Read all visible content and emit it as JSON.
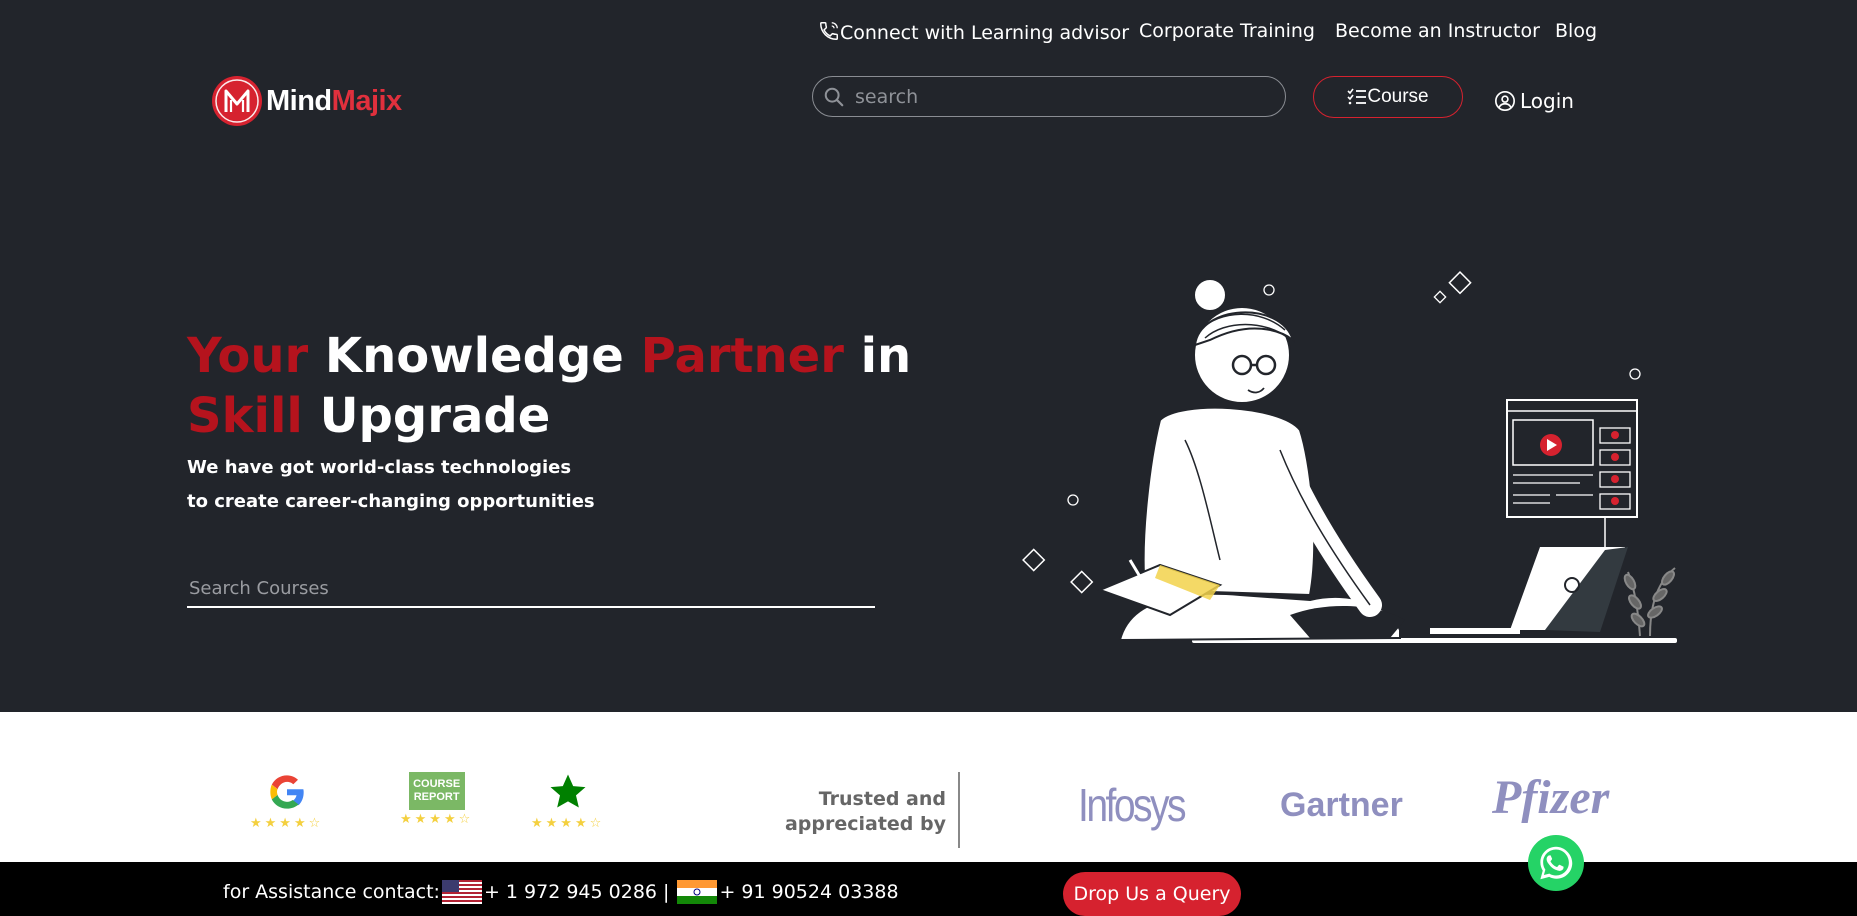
{
  "topnav": {
    "advisor": "Connect with Learning advisor",
    "corporate": "Corporate Training",
    "instructor": "Become an Instructor",
    "blog": "Blog"
  },
  "logo": {
    "part1": "Mind",
    "part2": "Majix"
  },
  "header": {
    "search_placeholder": "search",
    "course_label": "Course",
    "login_label": "Login"
  },
  "hero": {
    "headline": {
      "w1": "Your",
      "w2": "Knowledge",
      "w3": "Partner",
      "w4": "in",
      "w5": "Skill",
      "w6": "Upgrade"
    },
    "sub1": "We have got world-class technologies",
    "sub2": "to create career-changing opportunities",
    "search_placeholder": "Search Courses"
  },
  "ratings": [
    {
      "icon": "google-icon",
      "stars": "★★★★☆"
    },
    {
      "icon": "course-report-icon",
      "label": "COURSE REPORT",
      "stars": "★★★★☆"
    },
    {
      "icon": "star-icon",
      "stars": "★★★★☆"
    }
  ],
  "trusted": {
    "line1": "Trusted and",
    "line2": "appreciated by"
  },
  "brands": {
    "infosys": "Infosys",
    "gartner": "Gartner",
    "pfizer": "Pfizer"
  },
  "footer": {
    "assist_label": "for Assistance contact:",
    "us_phone": "+ 1 972 945 0286 |",
    "in_phone": "+ 91 90524 03388",
    "query_label": "Drop Us a Query"
  },
  "colors": {
    "brand_red": "#d6222f",
    "hero_bg": "#22252b",
    "headline_red": "#b5131d"
  }
}
